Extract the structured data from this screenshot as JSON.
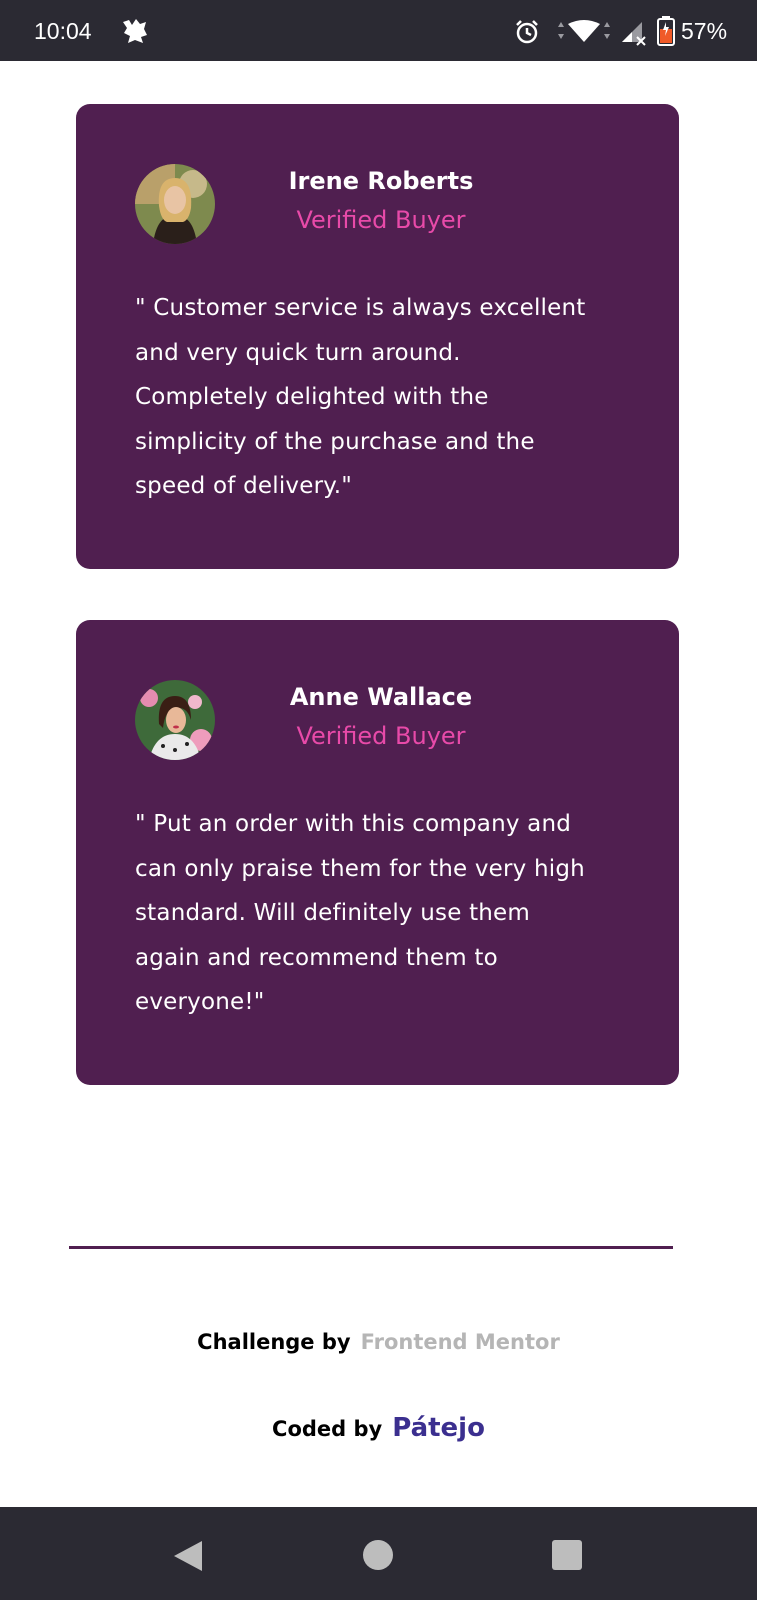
{
  "status_bar": {
    "time": "10:04",
    "battery": "57%",
    "icons": [
      "app-notification-icon",
      "alarm-icon",
      "wifi-icon",
      "cell-signal-icon",
      "battery-icon"
    ]
  },
  "testimonials": [
    {
      "name": "Irene Roberts",
      "role": "Verified Buyer",
      "quote": "\" Customer service is always excellent\nand very quick turn around.\nCompletely delighted with the\nsimplicity of the purchase and the\nspeed of delivery.\""
    },
    {
      "name": "Anne Wallace",
      "role": "Verified Buyer",
      "quote": "\" Put an order with this company and\ncan only praise them for the very high\nstandard. Will definitely use them\nagain and recommend them to\neveryone!\""
    }
  ],
  "footer": {
    "challenge_label": "Challenge by",
    "challenge_link": "Frontend Mentor",
    "coded_label": "Coded by",
    "coded_link": "Pátejo"
  },
  "nav_bar": {
    "icons": [
      "back-icon",
      "home-icon",
      "recents-icon"
    ]
  },
  "colors": {
    "card_bg": "#501f50",
    "accent_pink": "#e84aa9",
    "author_link": "#3b2f8f",
    "mentor_link": "#b5b5b5",
    "system_bar": "#2b2a33"
  }
}
